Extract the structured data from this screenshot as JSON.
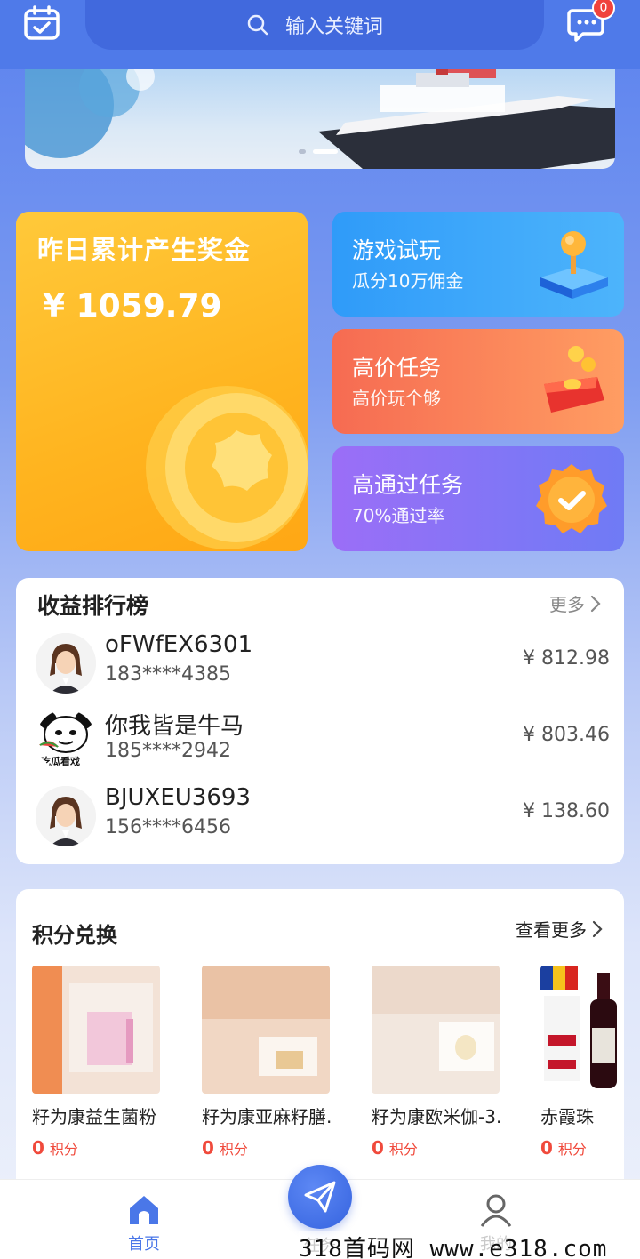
{
  "header": {
    "search_placeholder": "输入关键词",
    "message_badge": "0"
  },
  "banner": {
    "slide_count": 2,
    "active_slide": 2
  },
  "bonus": {
    "title": "昨日累计产生奖金",
    "amount": "¥ 1059.79"
  },
  "tasks": [
    {
      "title": "游戏试玩",
      "subtitle": "瓜分10万佣金",
      "icon": "joystick-icon",
      "color": "#2f9bf9"
    },
    {
      "title": "高价任务",
      "subtitle": "高价玩个够",
      "icon": "wallet-coins-icon",
      "color": "#f66b52"
    },
    {
      "title": "高通过任务",
      "subtitle": "70%通过率",
      "icon": "check-badge-icon",
      "color": "#8a72f6"
    }
  ],
  "ranking": {
    "title": "收益排行榜",
    "more_label": "更多",
    "rows": [
      {
        "name": "oFWfEX6301",
        "phone": "183****4385",
        "amount": "¥ 812.98",
        "avatar": "woman-avatar-icon"
      },
      {
        "name": "你我皆是牛马",
        "phone": "185****2942",
        "amount": "¥ 803.46",
        "avatar": "panda-meme-avatar-icon",
        "avatar_caption": "吃瓜看戏"
      },
      {
        "name": "BJUXEU3693",
        "phone": "156****6456",
        "amount": "¥ 138.60",
        "avatar": "woman-avatar-icon"
      }
    ]
  },
  "points": {
    "title": "积分兑换",
    "more_label": "查看更多",
    "unit": "积分",
    "products": [
      {
        "name": "籽为康益生菌粉",
        "points": "0"
      },
      {
        "name": "籽为康亚麻籽膳...",
        "points": "0"
      },
      {
        "name": "籽为康欧米伽-3...",
        "points": "0"
      },
      {
        "name": "赤霞珠",
        "points": "0"
      }
    ]
  },
  "nav": {
    "home": "首页",
    "task": "任务",
    "mine": "我的",
    "accent": "#4a77e8"
  },
  "watermark": "318首码网  www.e318.com"
}
